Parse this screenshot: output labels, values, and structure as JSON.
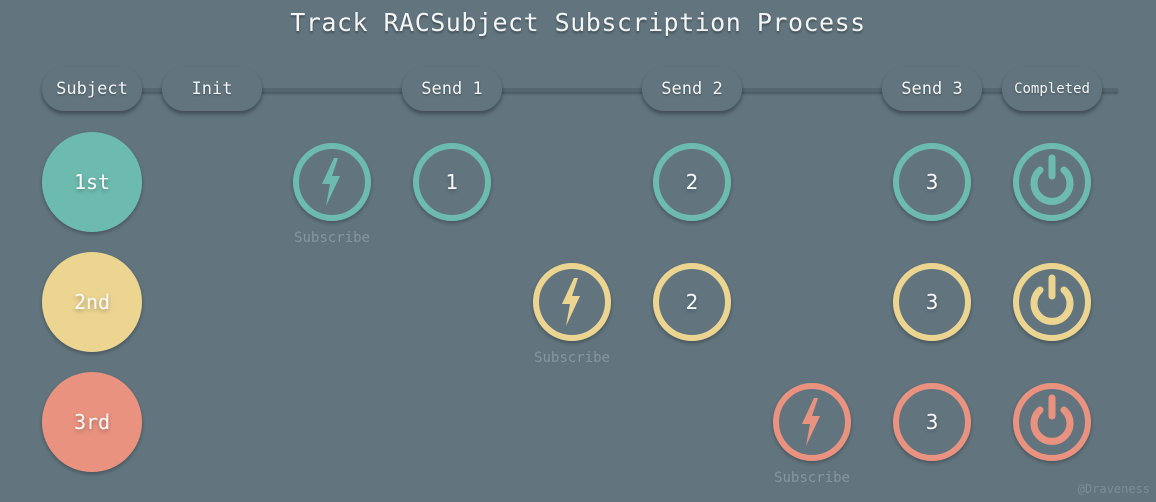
{
  "title": "Track RACSubject Subscription Process",
  "header": {
    "stages": [
      {
        "label": "Subject"
      },
      {
        "label": "Init"
      },
      {
        "label": "Send 1"
      },
      {
        "label": "Send 2"
      },
      {
        "label": "Send 3"
      },
      {
        "label": "Completed"
      }
    ]
  },
  "subscribe_label": "Subscribe",
  "watermark": "@Draveness",
  "colors": {
    "background": "#62757f",
    "subscriber_1": "#6dbbaf",
    "subscriber_2": "#ecd591",
    "subscriber_3": "#e9927f"
  },
  "subscribers": [
    {
      "label": "1st",
      "color": "#6dbbaf",
      "events": [
        {
          "type": "subscribe",
          "stage": "Init",
          "icon": "lightning-icon"
        },
        {
          "type": "value",
          "stage": "Send 1",
          "value": "1"
        },
        {
          "type": "value",
          "stage": "Send 2",
          "value": "2"
        },
        {
          "type": "value",
          "stage": "Send 3",
          "value": "3"
        },
        {
          "type": "completed",
          "stage": "Completed",
          "icon": "power-icon"
        }
      ]
    },
    {
      "label": "2nd",
      "color": "#ecd591",
      "events": [
        {
          "type": "subscribe",
          "stage": "Send 1.5",
          "icon": "lightning-icon"
        },
        {
          "type": "value",
          "stage": "Send 2",
          "value": "2"
        },
        {
          "type": "value",
          "stage": "Send 3",
          "value": "3"
        },
        {
          "type": "completed",
          "stage": "Completed",
          "icon": "power-icon"
        }
      ]
    },
    {
      "label": "3rd",
      "color": "#e9927f",
      "events": [
        {
          "type": "subscribe",
          "stage": "Send 2.5",
          "icon": "lightning-icon"
        },
        {
          "type": "value",
          "stage": "Send 3",
          "value": "3"
        },
        {
          "type": "completed",
          "stage": "Completed",
          "icon": "power-icon"
        }
      ]
    }
  ]
}
